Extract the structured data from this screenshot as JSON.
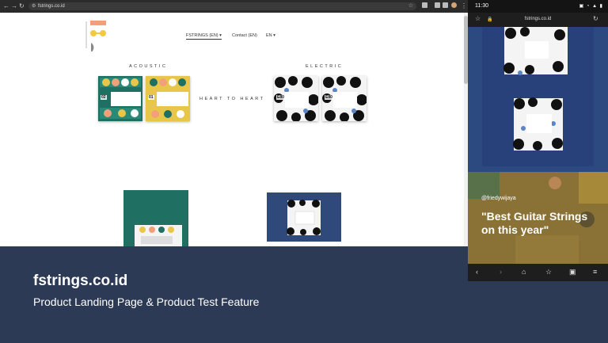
{
  "desktop_browser": {
    "url": "fstrings.co.id",
    "nav": [
      {
        "label": "FSTRINGS (EN)",
        "caret": "▾"
      },
      {
        "label": "Contact (EN)"
      },
      {
        "label": "EN",
        "caret": "▾"
      }
    ],
    "headings": {
      "acoustic": "ACOUSTIC",
      "electric": "ELECTRIC"
    },
    "tagline": "HEART TO HEART",
    "product_labels": {
      "acoustic_left": "02",
      "acoustic_right": "01",
      "electric_left": "E80",
      "electric_right": "E80"
    }
  },
  "phone": {
    "time": "11:30",
    "url": "fstrings.co.id",
    "handle": "@friedywijaya",
    "quote": "\"Best Guitar Strings on this year\""
  },
  "caption": {
    "title": "fstrings.co.id",
    "subtitle": "Product Landing Page & Product Test Feature"
  },
  "colors": {
    "caption_bg": "#2d3a56",
    "acoustic_green": "#1f7063",
    "acoustic_yellow": "#e8c64a",
    "electric_blue": "#2f4a7a",
    "logo_orange": "#f2a07b",
    "logo_yellow": "#f5c842"
  }
}
